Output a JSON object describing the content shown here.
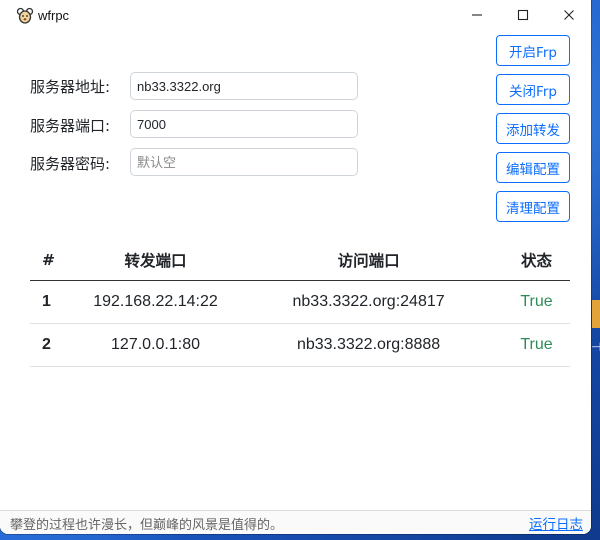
{
  "window": {
    "title": "wfrpc"
  },
  "form": {
    "server_addr_label": "服务器地址:",
    "server_addr_value": "nb33.3322.org",
    "server_port_label": "服务器端口:",
    "server_port_value": "7000",
    "server_pwd_label": "服务器密码:",
    "server_pwd_value": "",
    "server_pwd_placeholder": "默认空"
  },
  "buttons": {
    "start": "开启Frp",
    "stop": "关闭Frp",
    "add": "添加转发",
    "edit": "编辑配置",
    "clear": "清理配置"
  },
  "table": {
    "headers": [
      "#",
      "转发端口",
      "访问端口",
      "状态"
    ],
    "rows": [
      {
        "index": "1",
        "forward": "192.168.22.14:22",
        "access": "nb33.3322.org:24817",
        "status": "True"
      },
      {
        "index": "2",
        "forward": "127.0.0.1:80",
        "access": "nb33.3322.org:8888",
        "status": "True"
      }
    ]
  },
  "statusbar": {
    "text": "攀登的过程也许漫长，但巅峰的风景是值得的。",
    "log_link": "运行日志"
  },
  "colors": {
    "accent": "#0d6efd",
    "status_ok": "#2e8b57"
  },
  "icons": {
    "app": "app-logo-icon",
    "minimize": "minimize-icon",
    "maximize": "maximize-icon",
    "close": "close-icon"
  }
}
